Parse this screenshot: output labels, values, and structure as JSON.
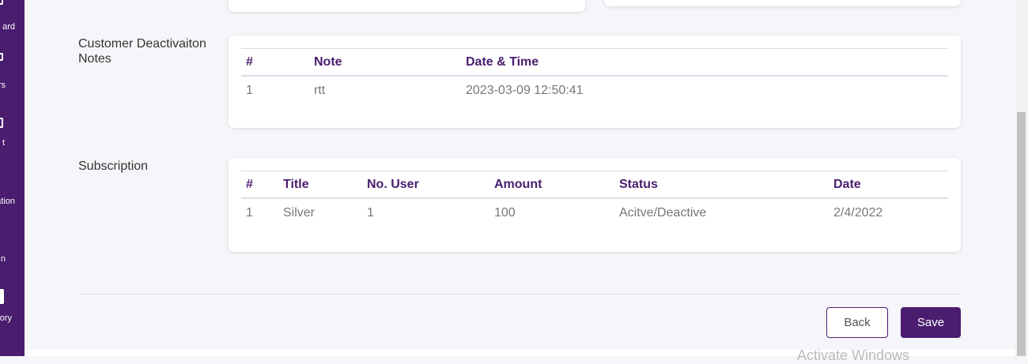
{
  "sidebar": {
    "items": [
      {
        "label": "ard"
      },
      {
        "label": "rs"
      },
      {
        "label": "t"
      },
      {
        "label": "ation"
      },
      {
        "label": "n"
      },
      {
        "label": "ory"
      }
    ]
  },
  "notes": {
    "section_label": "Customer Deactivaiton Notes",
    "columns": [
      "#",
      "Note",
      "Date & Time"
    ],
    "rows": [
      [
        "1",
        "rtt",
        "2023-03-09 12:50:41"
      ]
    ]
  },
  "subscription": {
    "section_label": "Subscription",
    "columns": [
      "#",
      "Title",
      "No. User",
      "Amount",
      "Status",
      "Date"
    ],
    "rows": [
      [
        "1",
        "Silver",
        "1",
        "100",
        "Acitve/Deactive",
        "2/4/2022"
      ]
    ]
  },
  "actions": {
    "back_label": "Back",
    "save_label": "Save"
  },
  "watermark": "Activate Windows",
  "colors": {
    "brand": "#4a1d6e",
    "background": "#f6f6fa"
  }
}
